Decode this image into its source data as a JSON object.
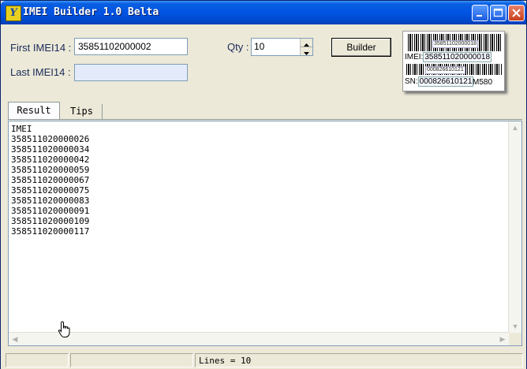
{
  "window": {
    "title": "IMEI Builder 1.0 Belta",
    "icon_glyph": "Y"
  },
  "form": {
    "first_label": "First IMEI14 :",
    "first_value": "35851102000002",
    "last_label": "Last IMEI14 :",
    "last_value": "",
    "qty_label": "Qty :",
    "qty_value": "10",
    "builder_button": "Builder"
  },
  "barcode_label": {
    "top_code": "35851102000018",
    "imei_label": "IMEI:",
    "imei_value": "358511020000018",
    "mid_code": "000826610121",
    "sn_label": "SN:",
    "sn_value": "000826610121",
    "model": "M580"
  },
  "tabs": [
    {
      "label": "Result",
      "active": true
    },
    {
      "label": "Tips",
      "active": false
    }
  ],
  "result": {
    "lines": [
      "IMEI",
      "358511020000026",
      "358511020000034",
      "358511020000042",
      "358511020000059",
      "358511020000067",
      "358511020000075",
      "358511020000083",
      "358511020000091",
      "358511020000109",
      "358511020000117"
    ]
  },
  "status": {
    "lines_text": "Lines = 10"
  }
}
